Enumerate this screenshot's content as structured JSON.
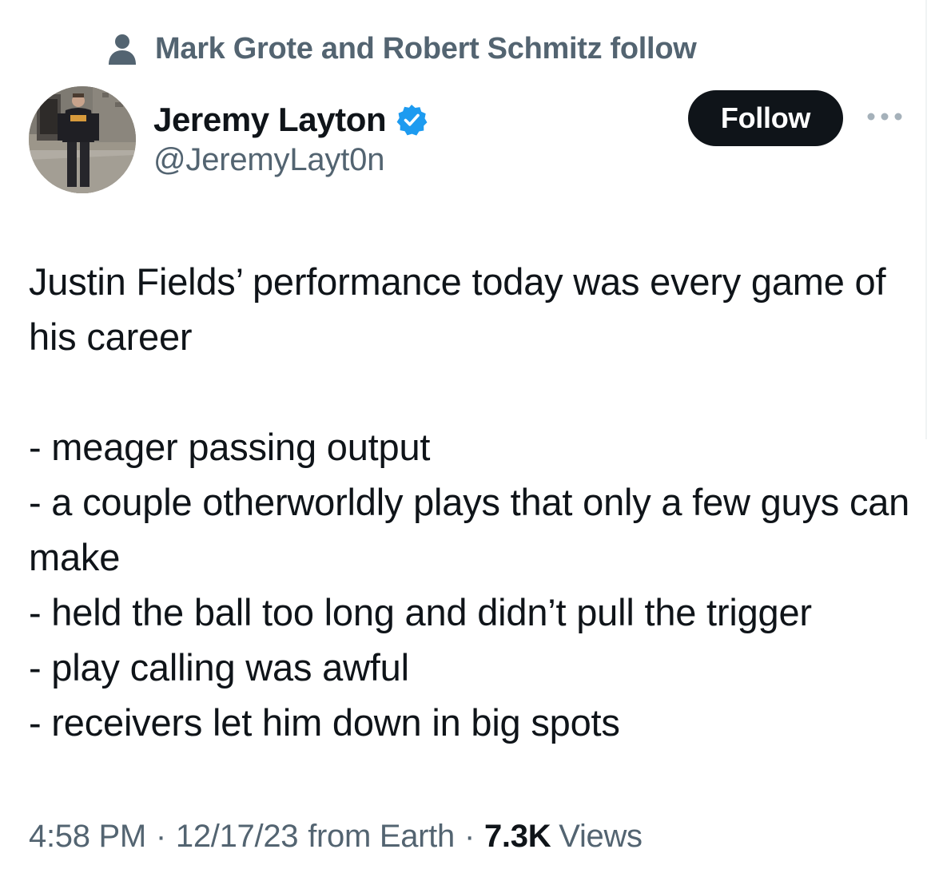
{
  "social_context": {
    "text": "Mark Grote and Robert Schmitz follow",
    "icon": "person-icon"
  },
  "author": {
    "display_name": "Jeremy Layton",
    "handle": "@JeremyLayt0n",
    "verified": true,
    "avatar_icon": "avatar"
  },
  "actions": {
    "follow_label": "Follow",
    "more_icon": "more-icon"
  },
  "tweet": {
    "text": "Justin Fields’ performance today was every game of his career\n\n- meager passing output\n- a couple otherworldly plays that only a few guys can make\n- held the ball too long and didn’t pull the trigger\n- play calling was awful\n- receivers let him down in big spots"
  },
  "meta": {
    "time": "4:58 PM",
    "separator": "·",
    "date": "12/17/23",
    "source": "from Earth",
    "views_count": "7.3K",
    "views_label": "Views"
  },
  "colors": {
    "text_primary": "#0f1419",
    "text_secondary": "#536471",
    "verified_blue": "#1d9bf0",
    "button_bg": "#0f1419"
  }
}
